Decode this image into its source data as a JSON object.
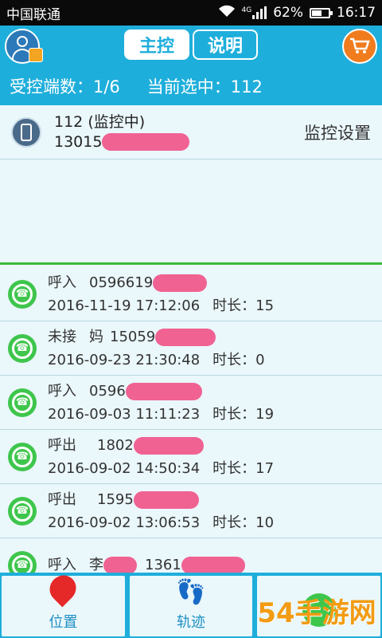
{
  "status": {
    "carrier": "中国联通",
    "network": "4G",
    "battery": "62%",
    "battery_level": 0.62,
    "time": "16:17"
  },
  "header": {
    "tabs": [
      {
        "label": "主控",
        "active": true
      },
      {
        "label": "说明",
        "active": false
      }
    ]
  },
  "counts": {
    "controlled_label": "受控端数：",
    "controlled_value": "1/6",
    "selected_label": "当前选中：",
    "selected_value": "112"
  },
  "device": {
    "name": "112",
    "state": "(监控中)",
    "number_prefix": "13015",
    "settings_label": "监控设置"
  },
  "calls": [
    {
      "type": "呼入",
      "contact": "",
      "number": "0596619",
      "datetime": "2016-11-19 17:12:06",
      "duration_label": "时长：",
      "duration": "15"
    },
    {
      "type": "未接",
      "contact": "妈",
      "number": "15059",
      "datetime": "2016-09-23 21:30:48",
      "duration_label": "时长：",
      "duration": "0"
    },
    {
      "type": "呼入",
      "contact": "",
      "number": "0596",
      "datetime": "2016-09-03 11:11:23",
      "duration_label": "时长：",
      "duration": "19"
    },
    {
      "type": "呼出",
      "contact": "",
      "number": "1802",
      "datetime": "2016-09-02 14:50:34",
      "duration_label": "时长：",
      "duration": "17"
    },
    {
      "type": "呼出",
      "contact": "",
      "number": "1595",
      "datetime": "2016-09-02 13:06:53",
      "duration_label": "时长：",
      "duration": "10"
    },
    {
      "type": "呼入",
      "contact": "李",
      "number": "1361",
      "datetime": "",
      "duration_label": "",
      "duration": ""
    }
  ],
  "nav": {
    "location": "位置",
    "track": "轨迹"
  },
  "watermark": "54手游网",
  "colors": {
    "accent": "#1eaedb",
    "redaction": "#f06292",
    "call_icon": "#3ec64c",
    "divider_green": "#3cba3c"
  }
}
